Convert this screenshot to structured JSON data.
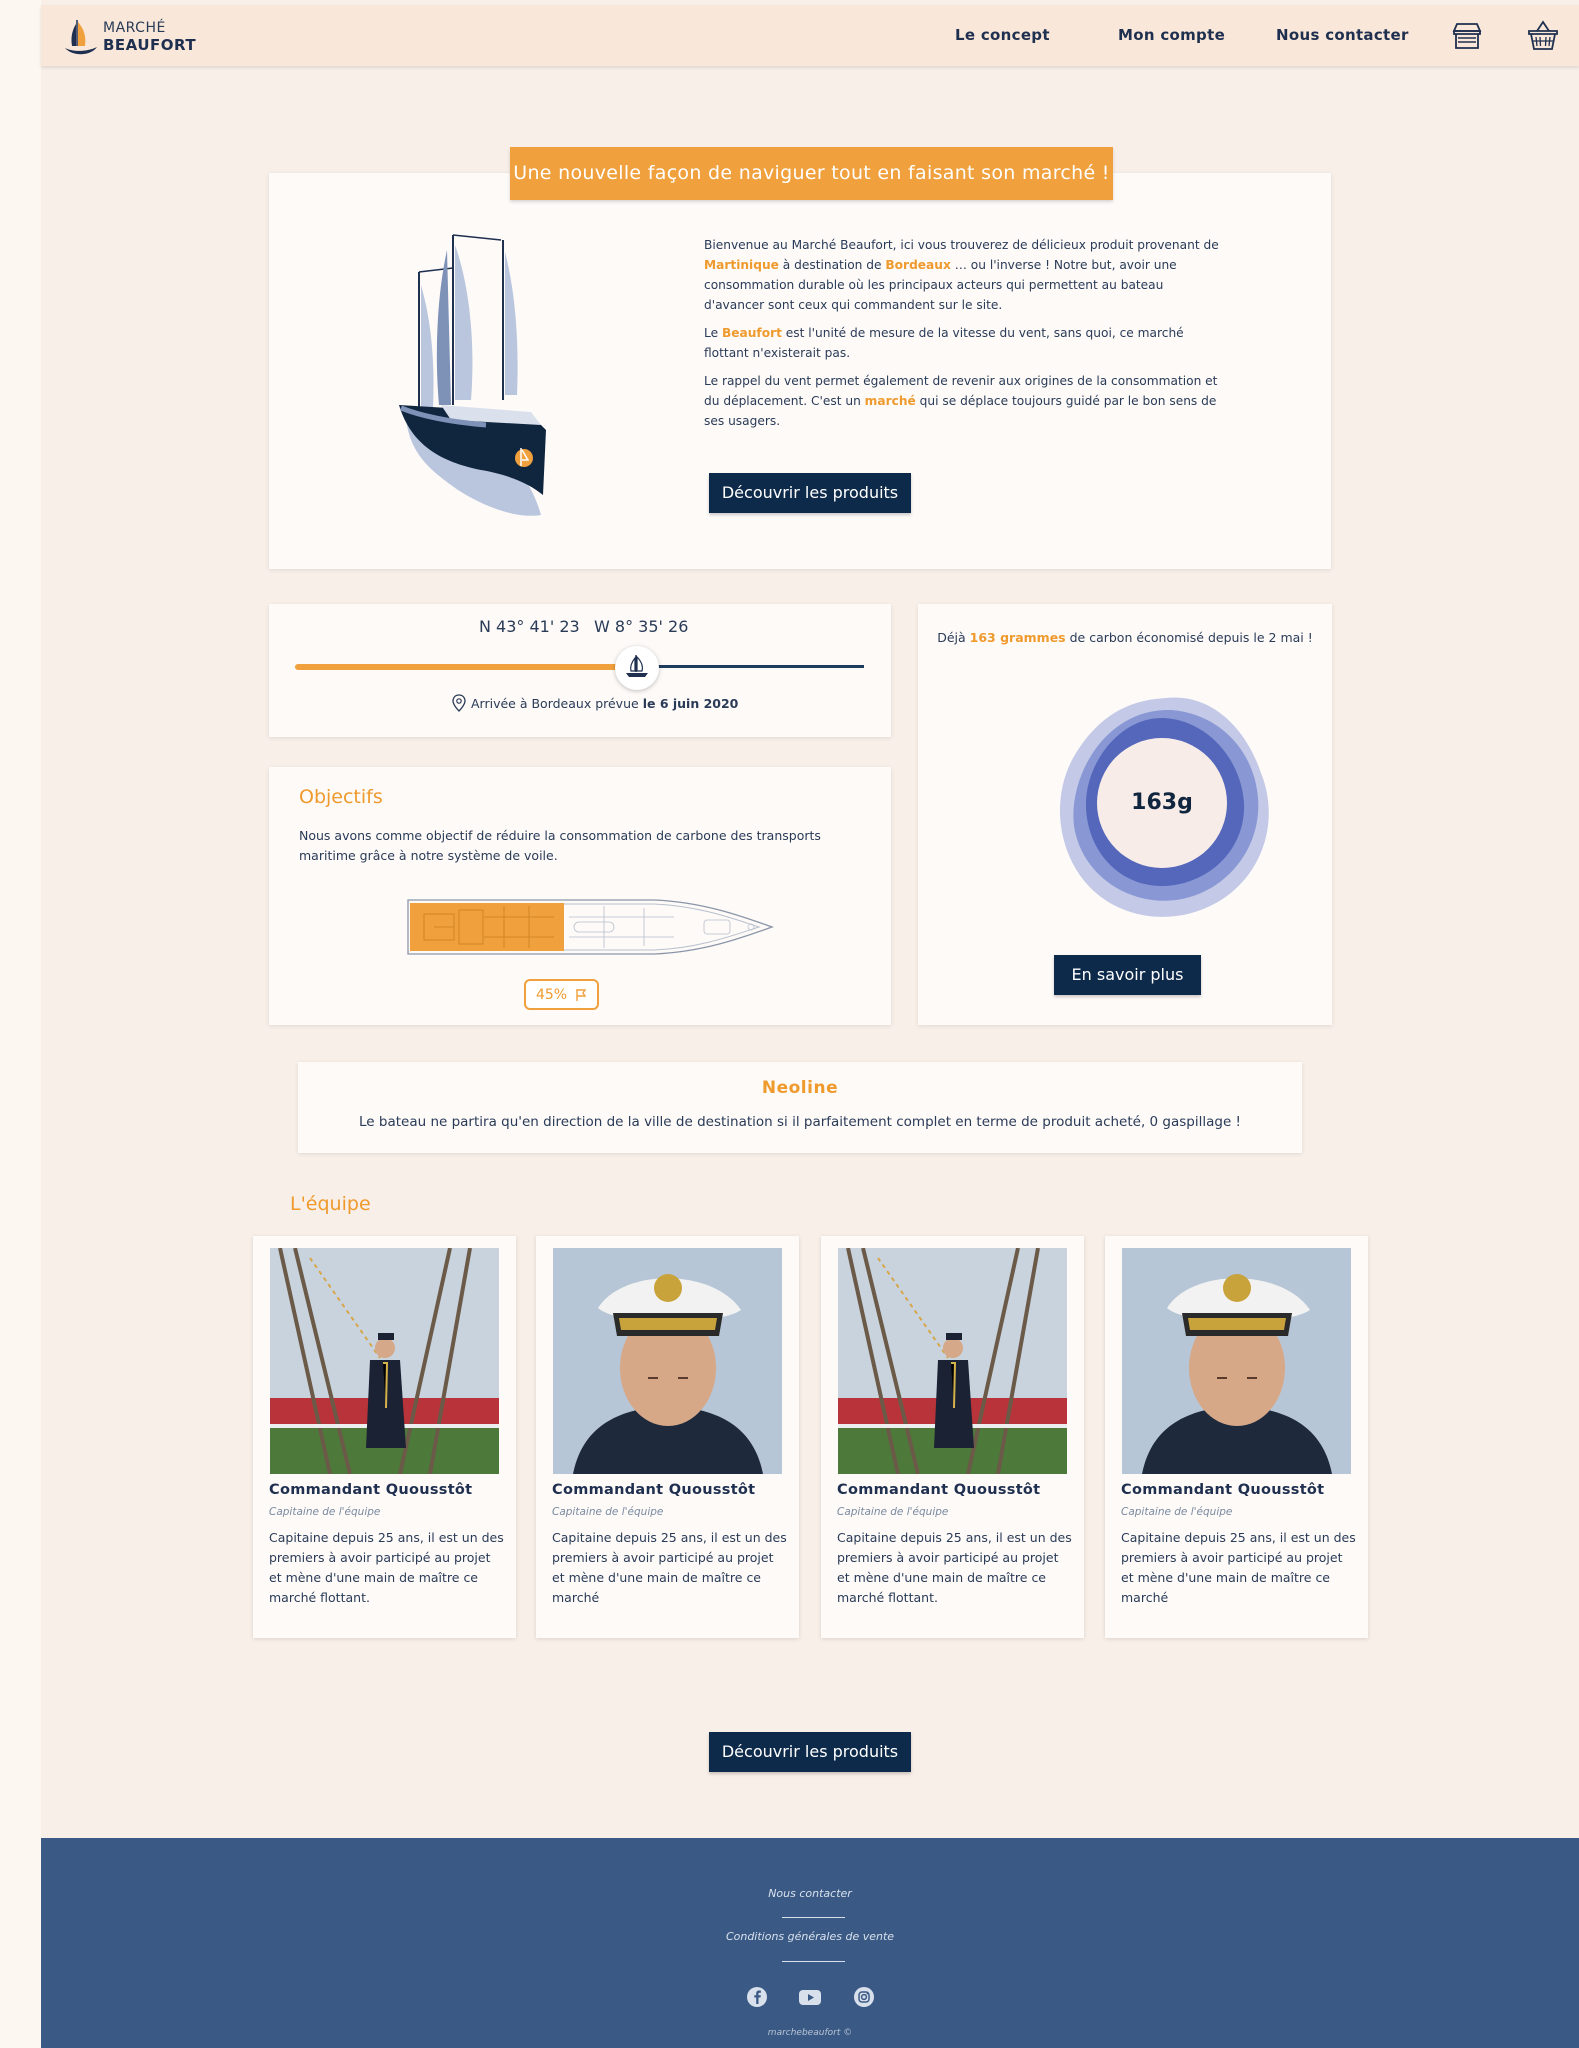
{
  "header": {
    "logo_top": "MARCHÉ",
    "logo_bottom": "BEAUFORT",
    "nav": [
      "Le concept",
      "Mon compte",
      "Nous contacter"
    ],
    "icons": [
      "store-icon",
      "basket-icon"
    ]
  },
  "hero": {
    "banner": "Une nouvelle façon de naviguer tout en faisant son marché !",
    "p1_a": " Bienvenue au Marché Beaufort, ici vous trouverez de délicieux produit provenant de ",
    "p1_hl1": "Martinique",
    "p1_b": " à destination de ",
    "p1_hl2": "Bordeaux",
    "p1_c": " … ou l'inverse ! Notre but, avoir une consommation durable où les principaux acteurs qui permettent au bateau d'avancer sont ceux qui commandent sur le site.",
    "p2_a": "Le ",
    "p2_hl": "Beaufort",
    "p2_b": " est l'unité de mesure de la vitesse du vent, sans quoi, ce marché flottant n'existerait pas.",
    "p3_a": "Le rappel du vent permet également de revenir aux origines de la consommation et du déplacement. C'est un ",
    "p3_hl": "marché",
    "p3_b": " qui se déplace toujours guidé par le bon sens de ses usagers.",
    "button": "Découvrir les produits"
  },
  "route": {
    "lat": "N 43° 41' 23",
    "lon": "W 8° 35' 26",
    "progress": 0.6,
    "arrival_text": "Arrivée à Bordeaux prévue",
    "arrival_date": "le 6 juin 2020"
  },
  "carbon": {
    "text_a": "Déjà ",
    "text_hl": "163 grammes",
    "text_b": " de carbon économisé depuis le 2 mai !",
    "value": "163g",
    "button": "En savoir plus"
  },
  "objectives": {
    "title": "Objectifs",
    "text": "Nous avons comme objectif de réduire la consommation de carbone des transports maritime grâce à notre système de voile.",
    "percent": "45%",
    "fill": 0.45
  },
  "neoline": {
    "title": "Neoline",
    "text": "Le bateau ne partira qu'en direction de la ville de destination si il parfaitement complet en terme de produit acheté, 0 gaspillage !"
  },
  "team": {
    "title": "L'équipe",
    "members": [
      {
        "name": "Commandant Quousstôt",
        "role": "Capitaine de l'équipe",
        "desc": "Capitaine depuis 25 ans, il est un des premiers à avoir participé au projet et mène d'une main de maître ce marché flottant."
      },
      {
        "name": "Commandant Quousstôt",
        "role": "Capitaine de l'équipe",
        "desc": "Capitaine depuis 25 ans, il est un des premiers à avoir participé au projet et mène d'une main de maître ce marché"
      },
      {
        "name": "Commandant Quousstôt",
        "role": "Capitaine de l'équipe",
        "desc": "Capitaine depuis 25 ans, il est un des premiers à avoir participé au projet et mène d'une main de maître ce marché flottant."
      },
      {
        "name": "Commandant Quousstôt",
        "role": "Capitaine de l'équipe",
        "desc": "Capitaine depuis 25 ans, il est un des premiers à avoir participé au projet et mène d'une main de maître ce marché"
      }
    ]
  },
  "bottom_button": "Découvrir les produits",
  "footer": {
    "contact": "Nous contacter",
    "cgv": "Conditions générales de vente",
    "social": [
      "facebook-icon",
      "youtube-icon",
      "instagram-icon"
    ],
    "copyright": "marchebeaufort ©"
  },
  "colors": {
    "accent": "#f0a03c",
    "navy": "#0d2a4a",
    "footer": "#3a5a85",
    "page_bg": "#f8efe8"
  }
}
